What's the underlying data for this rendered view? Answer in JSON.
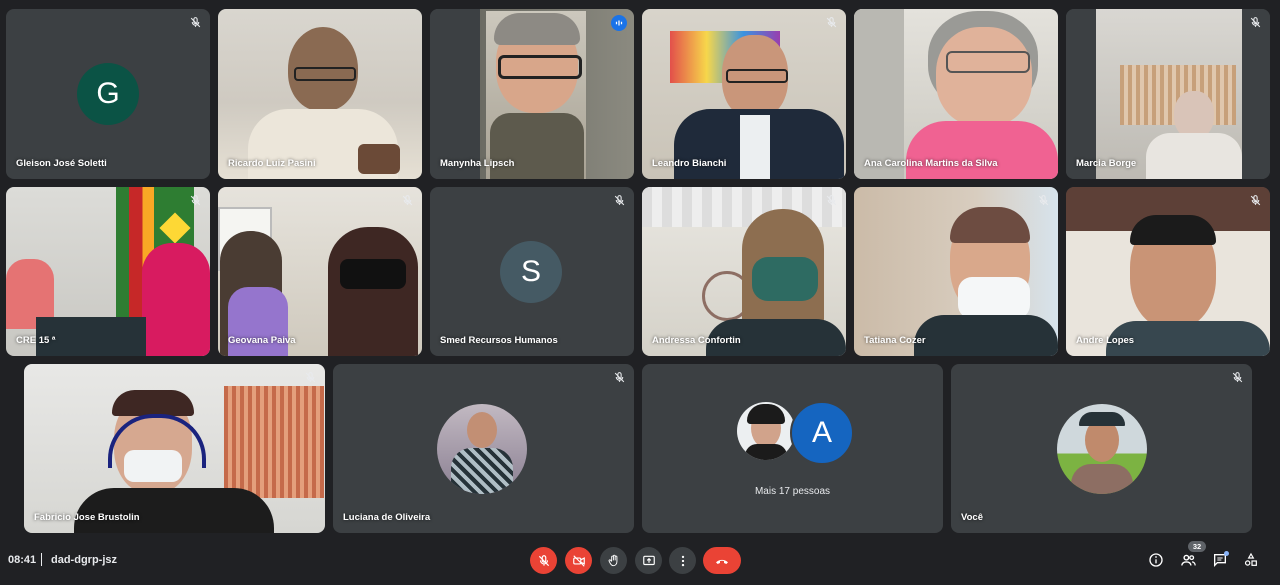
{
  "participants": [
    {
      "name": "Gleison José Soletti",
      "avatar_letter": "G",
      "avatar_color": "#0b5345",
      "muted": true
    },
    {
      "name": "Ricardo Luiz Pasini",
      "muted": false
    },
    {
      "name": "Manynha Lipsch",
      "speaking": true
    },
    {
      "name": "Leandro Bianchi",
      "muted": true
    },
    {
      "name": "Ana Carolina Martins da Silva",
      "muted": false
    },
    {
      "name": "Marcia Borge",
      "muted": true
    },
    {
      "name": "CRE 15 ª",
      "muted": true
    },
    {
      "name": "Geovana Paiva",
      "muted": true
    },
    {
      "name": "Smed Recursos Humanos",
      "avatar_letter": "S",
      "avatar_color": "#455a64",
      "muted": true
    },
    {
      "name": "Andressa Confortin",
      "muted": true
    },
    {
      "name": "Tatiana Cozer",
      "muted": true
    },
    {
      "name": "Andre Lopes",
      "muted": true
    },
    {
      "name": "Fabricio Jose Brustolin",
      "muted": true
    },
    {
      "name": "Luciana de Oliveira",
      "muted": true
    },
    {
      "more_label": "Mais 17 pessoas",
      "avatar_letter": "A",
      "avatar_color": "#1565c0",
      "muted": false
    },
    {
      "name": "Você",
      "muted": true
    }
  ],
  "bottombar": {
    "time": "08:41",
    "meeting_code": "dad-dgrp-jsz",
    "people_count": "32",
    "controls": [
      "mic-off-icon",
      "camera-off-icon",
      "raise-hand-icon",
      "present-icon",
      "more-options-icon",
      "end-call-icon"
    ],
    "right_icons": [
      "info-icon",
      "people-icon",
      "chat-icon",
      "activities-icon"
    ]
  },
  "colors": {
    "background": "#202124",
    "tile": "#3c4043",
    "danger": "#ea4335",
    "accent": "#1a73e8"
  }
}
